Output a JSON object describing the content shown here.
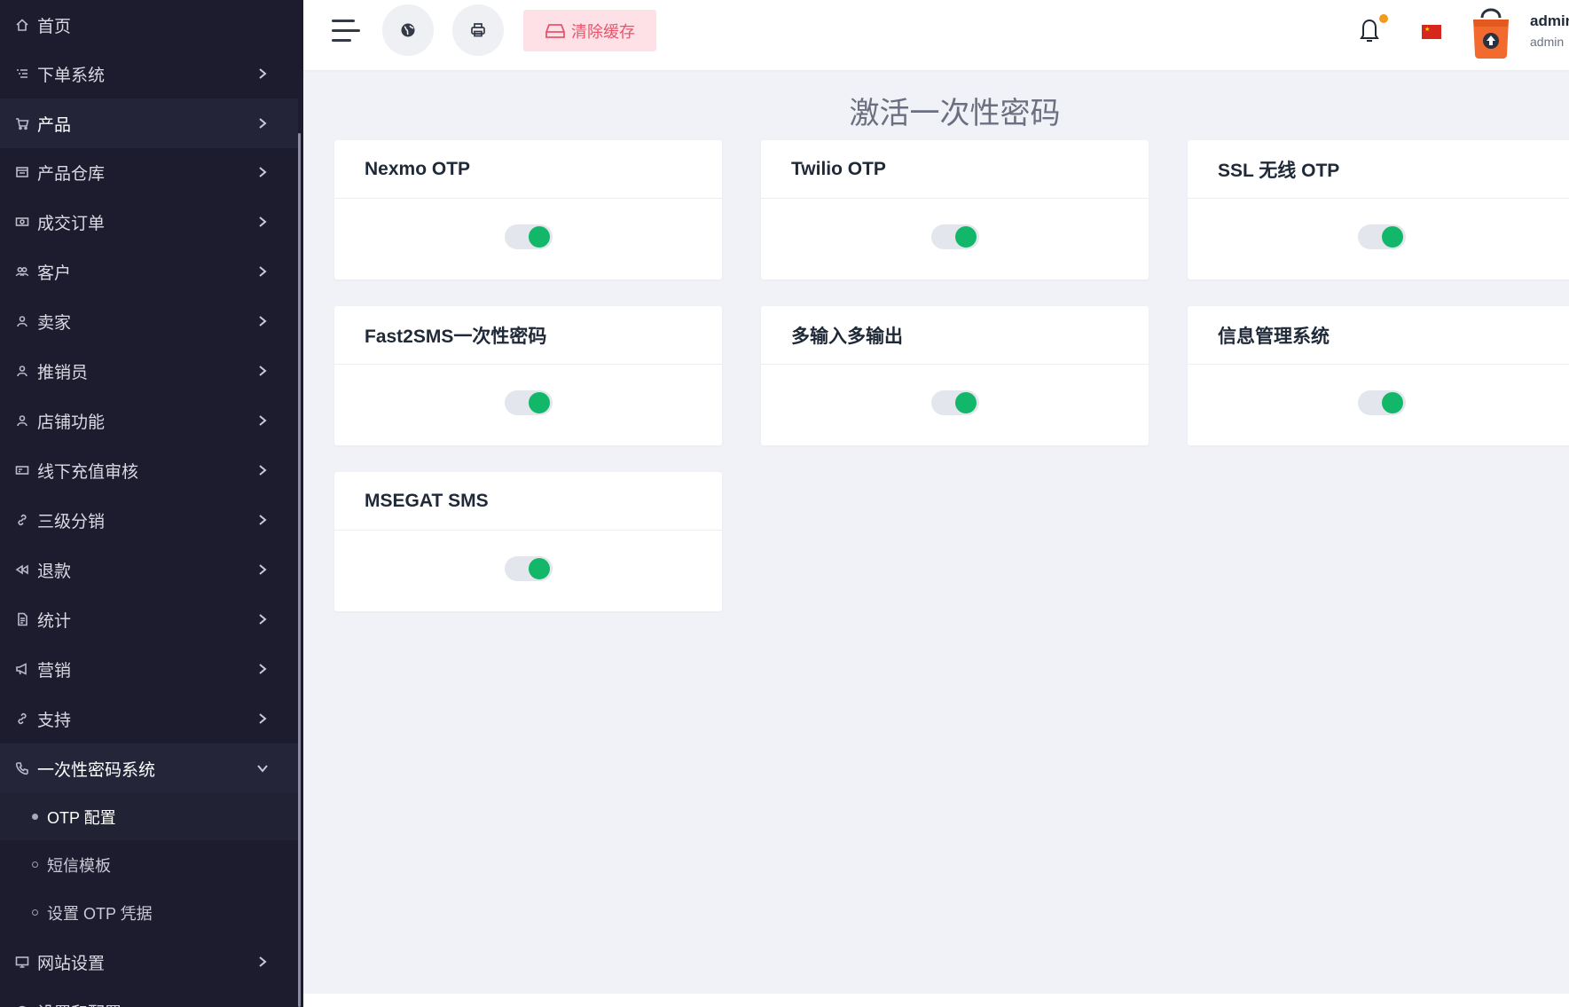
{
  "sidebar": {
    "items": [
      {
        "label": "首页",
        "icon": "home-icon"
      },
      {
        "label": "下单系统",
        "icon": "list-icon"
      },
      {
        "label": "产品",
        "icon": "cart-icon"
      },
      {
        "label": "产品仓库",
        "icon": "warehouse-icon"
      },
      {
        "label": "成交订单",
        "icon": "money-icon"
      },
      {
        "label": "客户",
        "icon": "users-icon"
      },
      {
        "label": "卖家",
        "icon": "user-icon"
      },
      {
        "label": "推销员",
        "icon": "user-icon"
      },
      {
        "label": "店铺功能",
        "icon": "user-icon"
      },
      {
        "label": "线下充值审核",
        "icon": "card-icon"
      },
      {
        "label": "三级分销",
        "icon": "link-icon"
      },
      {
        "label": "退款",
        "icon": "rewind-icon"
      },
      {
        "label": "统计",
        "icon": "document-icon"
      },
      {
        "label": "营销",
        "icon": "megaphone-icon"
      },
      {
        "label": "支持",
        "icon": "link-icon"
      },
      {
        "label": "一次性密码系统",
        "icon": "phone-icon"
      },
      {
        "label": "网站设置",
        "icon": "monitor-icon"
      },
      {
        "label": "设置和配置",
        "icon": "settings-icon"
      }
    ],
    "sub_items": [
      {
        "label": "OTP 配置"
      },
      {
        "label": "短信模板"
      },
      {
        "label": "设置 OTP 凭据"
      }
    ]
  },
  "topbar": {
    "clear_cache_label": "清除缓存",
    "user_name": "admin",
    "user_role": "admin",
    "flag_star": "★"
  },
  "main": {
    "title": "激活一次性密码",
    "cards": [
      {
        "title": "Nexmo OTP",
        "enabled": true
      },
      {
        "title": "Twilio OTP",
        "enabled": true
      },
      {
        "title": "SSL 无线 OTP",
        "enabled": true
      },
      {
        "title": "Fast2SMS一次性密码",
        "enabled": true
      },
      {
        "title": "多输入多输出",
        "enabled": true
      },
      {
        "title": "信息管理系统",
        "enabled": true
      },
      {
        "title": "MSEGAT SMS",
        "enabled": true
      }
    ]
  },
  "colors": {
    "sidebar_bg": "#1c1c2e",
    "toggle_on": "#12b76a",
    "cache_button_bg": "#fde1e6",
    "cache_button_text": "#e8546c",
    "notification_dot": "#f29b1d"
  }
}
